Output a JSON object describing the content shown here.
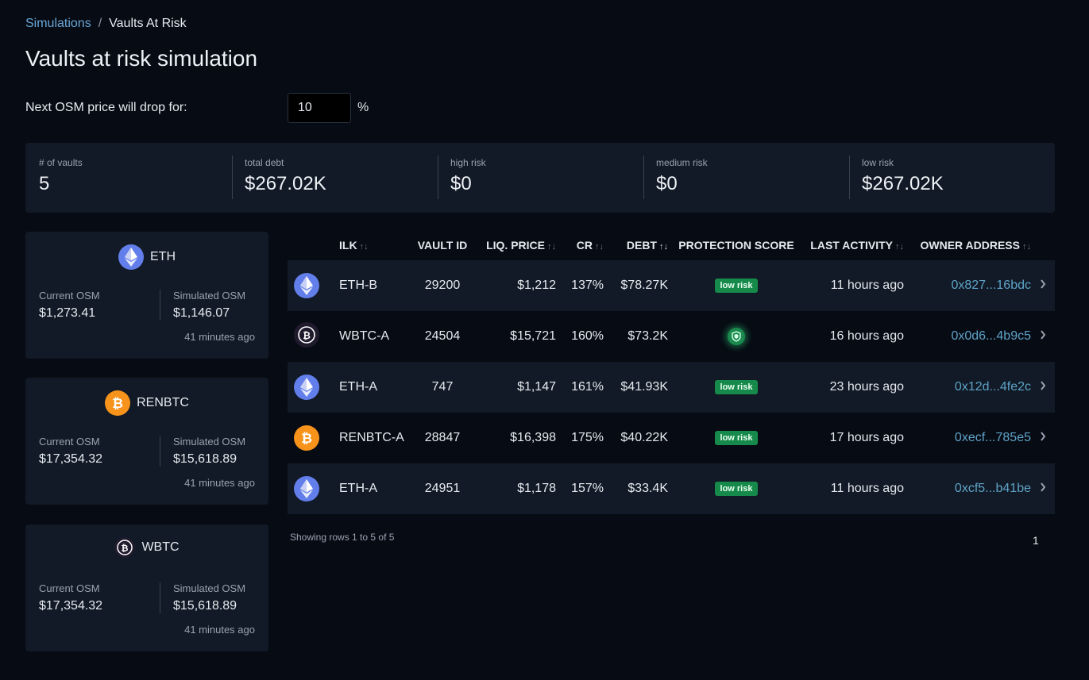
{
  "breadcrumb": {
    "parent": "Simulations",
    "separator": "/",
    "current": "Vaults At Risk"
  },
  "title": "Vaults at risk simulation",
  "drop": {
    "label": "Next OSM price will drop for:",
    "value": "10",
    "unit": "%"
  },
  "summary": [
    {
      "label": "# of vaults",
      "value": "5"
    },
    {
      "label": "total debt",
      "value": "$267.02K"
    },
    {
      "label": "high risk",
      "value": "$0"
    },
    {
      "label": "medium risk",
      "value": "$0"
    },
    {
      "label": "low risk",
      "value": "$267.02K"
    }
  ],
  "assets": [
    {
      "name": "ETH",
      "icon": "eth-icon",
      "current_label": "Current OSM",
      "current": "$1,273.41",
      "sim_label": "Simulated OSM",
      "sim": "$1,146.07",
      "time": "41 minutes ago"
    },
    {
      "name": "RENBTC",
      "icon": "btc-icon",
      "current_label": "Current OSM",
      "current": "$17,354.32",
      "sim_label": "Simulated OSM",
      "sim": "$15,618.89",
      "time": "41 minutes ago"
    },
    {
      "name": "WBTC",
      "icon": "wbtc-icon",
      "current_label": "Current OSM",
      "current": "$17,354.32",
      "sim_label": "Simulated OSM",
      "sim": "$15,618.89",
      "time": "41 minutes ago"
    }
  ],
  "table": {
    "headers": {
      "ilk": "ILK",
      "vault_id": "VAULT ID",
      "liq_price": "LIQ. PRICE",
      "cr": "CR",
      "debt": "DEBT",
      "protection": "PROTECTION SCORE",
      "last_activity": "LAST ACTIVITY",
      "owner": "OWNER ADDRESS",
      "sort_glyph": "↑↓"
    },
    "rows": [
      {
        "icon": "eth-icon",
        "ilk": "ETH-B",
        "vault_id": "29200",
        "liq_price": "$1,212",
        "cr": "137%",
        "debt": "$78.27K",
        "protection": "low risk",
        "last_activity": "11 hours ago",
        "owner": "0x827...16bdc"
      },
      {
        "icon": "wbtc-icon",
        "ilk": "WBTC-A",
        "vault_id": "24504",
        "liq_price": "$15,721",
        "cr": "160%",
        "debt": "$73.2K",
        "protection": "shield-icon",
        "last_activity": "16 hours ago",
        "owner": "0x0d6...4b9c5"
      },
      {
        "icon": "eth-icon",
        "ilk": "ETH-A",
        "vault_id": "747",
        "liq_price": "$1,147",
        "cr": "161%",
        "debt": "$41.93K",
        "protection": "low risk",
        "last_activity": "23 hours ago",
        "owner": "0x12d...4fe2c"
      },
      {
        "icon": "btc-icon",
        "ilk": "RENBTC-A",
        "vault_id": "28847",
        "liq_price": "$16,398",
        "cr": "175%",
        "debt": "$40.22K",
        "protection": "low risk",
        "last_activity": "17 hours ago",
        "owner": "0xecf...785e5"
      },
      {
        "icon": "eth-icon",
        "ilk": "ETH-A",
        "vault_id": "24951",
        "liq_price": "$1,178",
        "cr": "157%",
        "debt": "$33.4K",
        "protection": "low risk",
        "last_activity": "11 hours ago",
        "owner": "0xcf5...b41be"
      }
    ]
  },
  "footer": {
    "showing": "Showing rows 1 to 5 of 5",
    "page": "1"
  },
  "colors": {
    "background": "#070b14",
    "card": "#111a26",
    "link": "#5fa3c8",
    "badge": "#168a4a",
    "eth": "#627eea",
    "btc": "#f7931a"
  }
}
